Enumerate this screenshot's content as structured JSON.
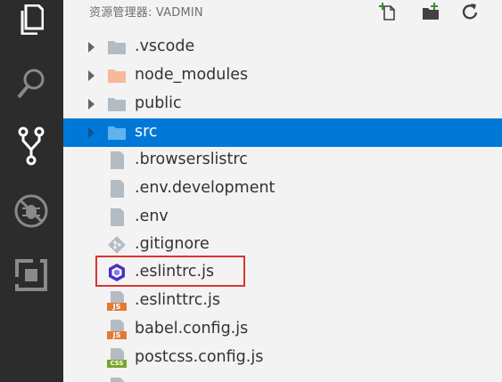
{
  "explorer": {
    "title": "资源管理器: VADMIN",
    "actions": [
      "new-file-icon",
      "new-folder-icon",
      "refresh-icon"
    ]
  },
  "activity_bar": [
    "files-icon",
    "search-icon",
    "source-control-icon",
    "debug-icon",
    "extensions-icon"
  ],
  "tree": [
    {
      "label": ".vscode",
      "kind": "folder",
      "icon": "folder-icon",
      "color": "#b4bcc3"
    },
    {
      "label": "node_modules",
      "kind": "folder",
      "icon": "folder-icon",
      "color": "#f8b89a"
    },
    {
      "label": "public",
      "kind": "folder",
      "icon": "folder-icon",
      "color": "#b4bcc3"
    },
    {
      "label": "src",
      "kind": "folder",
      "icon": "folder-icon",
      "color": "#61b3ef",
      "selected": true
    },
    {
      "label": ".browserslistrc",
      "kind": "file",
      "icon": "file-icon"
    },
    {
      "label": ".env.development",
      "kind": "file",
      "icon": "file-icon"
    },
    {
      "label": ".env",
      "kind": "file",
      "icon": "file-icon"
    },
    {
      "label": ".gitignore",
      "kind": "file",
      "icon": "git-icon"
    },
    {
      "label": ".eslintrc.js",
      "kind": "file",
      "icon": "eslint-icon",
      "highlighted": true
    },
    {
      "label": ".eslinttrc.js",
      "kind": "file",
      "icon": "js-file-icon",
      "badge": "JS"
    },
    {
      "label": "babel.config.js",
      "kind": "file",
      "icon": "js-file-icon",
      "badge": "JS"
    },
    {
      "label": "postcss.config.js",
      "kind": "file",
      "icon": "css-file-icon",
      "badge": "CSS"
    }
  ],
  "colors": {
    "selection": "#0078d7",
    "highlight_box": "#d9352d",
    "activity_bar": "#2c2c2c",
    "js_badge": "#e37933",
    "css_badge": "#7aa52b"
  }
}
